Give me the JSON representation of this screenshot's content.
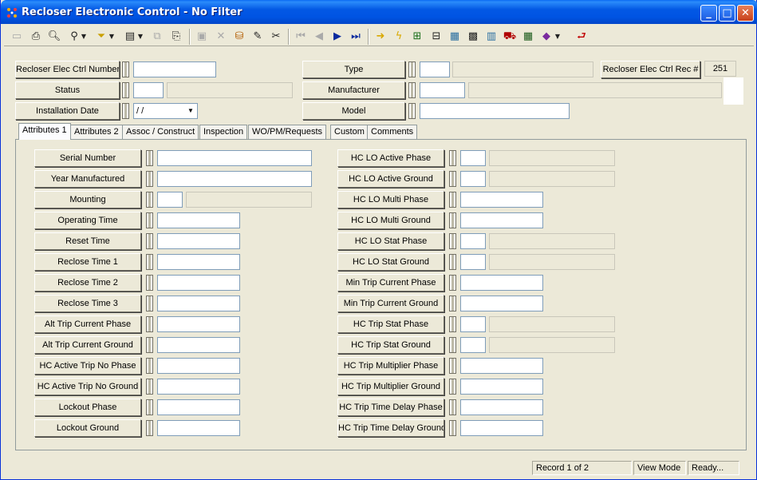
{
  "window": {
    "title": "Recloser Electronic Control - No Filter"
  },
  "title_buttons": {
    "minimize": "_",
    "maximize": "□",
    "close": "✕"
  },
  "header": {
    "rec_number_label": "Recloser Elec Ctrl Number",
    "status_label": "Status",
    "installation_date_label": "Installation Date",
    "installation_date_value": " / /",
    "type_label": "Type",
    "manufacturer_label": "Manufacturer",
    "model_label": "Model",
    "rec_id_label": "Recloser Elec Ctrl Rec #",
    "rec_id_value": "251"
  },
  "tabs": [
    {
      "label": "Attributes 1"
    },
    {
      "label": "Attributes 2"
    },
    {
      "label": "Assoc / Construct"
    },
    {
      "label": "Inspection"
    },
    {
      "label": "WO/PM/Requests"
    },
    {
      "label": "Custom"
    },
    {
      "label": "Comments"
    }
  ],
  "left_fields": [
    {
      "label": "Serial Number"
    },
    {
      "label": "Year Manufactured"
    },
    {
      "label": "Mounting"
    },
    {
      "label": "Operating Time"
    },
    {
      "label": "Reset Time"
    },
    {
      "label": "Reclose Time 1"
    },
    {
      "label": "Reclose Time 2"
    },
    {
      "label": "Reclose Time 3"
    },
    {
      "label": "Alt Trip Current Phase"
    },
    {
      "label": "Alt Trip Current Ground"
    },
    {
      "label": "HC Active Trip No Phase"
    },
    {
      "label": "HC Active Trip No Ground"
    },
    {
      "label": "Lockout Phase"
    },
    {
      "label": "Lockout Ground"
    }
  ],
  "right_fields": [
    {
      "label": "HC LO Active Phase"
    },
    {
      "label": "HC LO Active Ground"
    },
    {
      "label": "HC LO Multi Phase"
    },
    {
      "label": "HC LO Multi Ground"
    },
    {
      "label": "HC LO Stat Phase"
    },
    {
      "label": "HC LO Stat Ground"
    },
    {
      "label": "Min Trip Current Phase"
    },
    {
      "label": "Min Trip Current Ground"
    },
    {
      "label": "HC Trip Stat Phase"
    },
    {
      "label": "HC Trip Stat Ground"
    },
    {
      "label": "HC Trip Multiplier Phase"
    },
    {
      "label": "HC Trip Multiplier Ground"
    },
    {
      "label": "HC Trip Time Delay Phase"
    },
    {
      "label": "HC Trip Time Delay Ground"
    }
  ],
  "status": {
    "record": "Record 1 of 2",
    "mode": "View Mode",
    "state": "Ready..."
  },
  "toolbar_icons": [
    "new-record-icon",
    "print-icon",
    "print-preview-icon",
    "find-icon",
    "filter-icon",
    "form-view-icon",
    "copy-icon",
    "paste-icon",
    "save-icon",
    "delete-icon",
    "undo-icon",
    "edit-icon",
    "cut-icon",
    "first-record-icon",
    "prev-record-icon",
    "next-record-icon",
    "last-record-icon",
    "goto-icon",
    "lightning-icon",
    "map-icon",
    "tree-icon",
    "chart-icon",
    "calc-icon",
    "report-icon",
    "wrench-icon",
    "grid-icon",
    "book-icon",
    "exit-icon"
  ]
}
